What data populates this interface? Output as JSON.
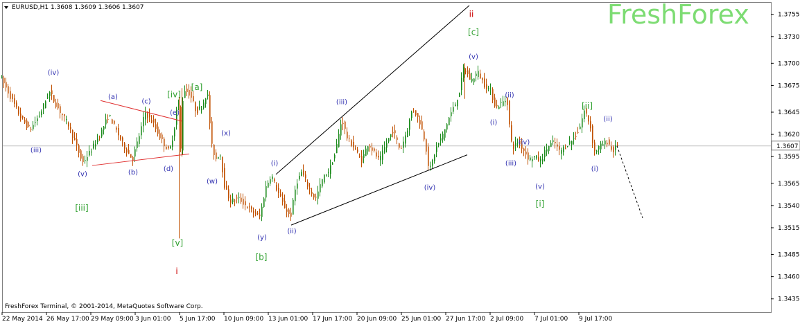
{
  "header": {
    "symbol_line": "EURUSD,H1 1.3608 1.3609 1.3606 1.3607"
  },
  "watermark": {
    "text": "FreshForex"
  },
  "footer": {
    "copyright": "FreshForex Terminal, © 2001-2014, MetaQuotes Software Corp."
  },
  "colors": {
    "bull_candle": "#1a8a1a",
    "bear_candle": "#c05000",
    "price_line": "#c0c0c0",
    "minor_labels": "#3030b0",
    "green_labels": "#2fa02f",
    "red_labels": "#cc0000",
    "triangle_lines": "#e03030",
    "channel_lines": "#000000",
    "watermark": "#7ddc73"
  },
  "chart_data": {
    "type": "candlestick",
    "symbol": "EURUSD",
    "timeframe": "H1",
    "last_bar": {
      "open": 1.3608,
      "high": 1.3609,
      "low": 1.3606,
      "close": 1.3607
    },
    "current_price_label": "1.3607",
    "y_range": [
      1.3425,
      1.3775
    ],
    "y_ticks": [
      "1.3755",
      "1.3730",
      "1.3700",
      "1.3675",
      "1.3645",
      "1.3620",
      "1.3595",
      "1.3565",
      "1.3540",
      "1.3515",
      "1.3485",
      "1.3460",
      "1.3435"
    ],
    "x_ticks": [
      "22 May 2014",
      "26 May 17:00",
      "29 May 09:00",
      "3 Jun 01:00",
      "5 Jun 17:00",
      "10 Jun 09:00",
      "13 Jun 01:00",
      "17 Jun 17:00",
      "20 Jun 09:00",
      "25 Jun 01:00",
      "27 Jun 17:00",
      "2 Jul 09:00",
      "7 Jul 01:00",
      "9 Jul 17:00"
    ],
    "price_path": [
      [
        0,
        1.3688
      ],
      [
        14,
        1.3665
      ],
      [
        30,
        1.364
      ],
      [
        44,
        1.3625
      ],
      [
        58,
        1.3642
      ],
      [
        72,
        1.3668
      ],
      [
        84,
        1.365
      ],
      [
        100,
        1.363
      ],
      [
        112,
        1.3605
      ],
      [
        120,
        1.3588
      ],
      [
        132,
        1.3602
      ],
      [
        145,
        1.362
      ],
      [
        158,
        1.3642
      ],
      [
        168,
        1.3625
      ],
      [
        180,
        1.3606
      ],
      [
        192,
        1.3592
      ],
      [
        202,
        1.362
      ],
      [
        210,
        1.3645
      ],
      [
        222,
        1.3632
      ],
      [
        235,
        1.3612
      ],
      [
        245,
        1.36
      ],
      [
        252,
        1.3625
      ],
      [
        258,
        1.3662
      ],
      [
        262,
        1.3595
      ],
      [
        265,
        1.3672
      ],
      [
        275,
        1.3665
      ],
      [
        284,
        1.3645
      ],
      [
        292,
        1.3652
      ],
      [
        300,
        1.3668
      ],
      [
        306,
        1.3608
      ],
      [
        312,
        1.3592
      ],
      [
        318,
        1.36
      ],
      [
        325,
        1.356
      ],
      [
        333,
        1.3545
      ],
      [
        345,
        1.3548
      ],
      [
        358,
        1.3538
      ],
      [
        370,
        1.353
      ],
      [
        376,
        1.3528
      ],
      [
        384,
        1.356
      ],
      [
        392,
        1.3575
      ],
      [
        400,
        1.3558
      ],
      [
        410,
        1.354
      ],
      [
        420,
        1.3527
      ],
      [
        428,
        1.3565
      ],
      [
        436,
        1.3578
      ],
      [
        446,
        1.356
      ],
      [
        456,
        1.3547
      ],
      [
        466,
        1.357
      ],
      [
        476,
        1.358
      ],
      [
        484,
        1.3598
      ],
      [
        494,
        1.3638
      ],
      [
        502,
        1.3615
      ],
      [
        512,
        1.3605
      ],
      [
        522,
        1.359
      ],
      [
        532,
        1.361
      ],
      [
        540,
        1.36
      ],
      [
        548,
        1.359
      ],
      [
        558,
        1.361
      ],
      [
        568,
        1.3625
      ],
      [
        578,
        1.3602
      ],
      [
        588,
        1.3625
      ],
      [
        596,
        1.365
      ],
      [
        606,
        1.3635
      ],
      [
        614,
        1.3612
      ],
      [
        620,
        1.3578
      ],
      [
        630,
        1.3605
      ],
      [
        640,
        1.362
      ],
      [
        650,
        1.3642
      ],
      [
        658,
        1.3655
      ],
      [
        664,
        1.367
      ],
      [
        670,
        1.3696
      ],
      [
        680,
        1.368
      ],
      [
        690,
        1.369
      ],
      [
        700,
        1.3675
      ],
      [
        708,
        1.367
      ],
      [
        716,
        1.365
      ],
      [
        724,
        1.3655
      ],
      [
        732,
        1.366
      ],
      [
        737,
        1.3618
      ],
      [
        740,
        1.3605
      ],
      [
        748,
        1.3612
      ],
      [
        756,
        1.3603
      ],
      [
        764,
        1.3592
      ],
      [
        772,
        1.3595
      ],
      [
        780,
        1.359
      ],
      [
        790,
        1.3605
      ],
      [
        800,
        1.3612
      ],
      [
        808,
        1.36
      ],
      [
        818,
        1.3608
      ],
      [
        828,
        1.3615
      ],
      [
        836,
        1.3625
      ],
      [
        844,
        1.3648
      ],
      [
        852,
        1.363
      ],
      [
        858,
        1.36
      ],
      [
        864,
        1.3605
      ],
      [
        872,
        1.361
      ],
      [
        878,
        1.3612
      ],
      [
        884,
        1.36
      ],
      [
        890,
        1.3607
      ]
    ],
    "wave_labels": [
      {
        "text": "(iv)",
        "group": "minor",
        "x": 77,
        "price": 1.369
      },
      {
        "text": "(iii)",
        "group": "minor",
        "x": 52,
        "price": 1.3603
      },
      {
        "text": "(v)",
        "group": "minor",
        "x": 119,
        "price": 1.3576
      },
      {
        "text": "[iii]",
        "group": "green",
        "x": 118,
        "price": 1.3537
      },
      {
        "text": "(a)",
        "group": "minor",
        "x": 163,
        "price": 1.3663
      },
      {
        "text": "(b)",
        "group": "minor",
        "x": 192,
        "price": 1.3578
      },
      {
        "text": "(c)",
        "group": "minor",
        "x": 211,
        "price": 1.3658
      },
      {
        "text": "(d)",
        "group": "minor",
        "x": 243,
        "price": 1.3582
      },
      {
        "text": "(e)",
        "group": "minor",
        "x": 252,
        "price": 1.3645
      },
      {
        "text": "[iv]",
        "group": "green",
        "x": 251,
        "price": 1.3665
      },
      {
        "text": "[a]",
        "group": "green",
        "x": 284,
        "price": 1.3673
      },
      {
        "text": "[v]",
        "group": "green",
        "x": 256,
        "price": 1.3498
      },
      {
        "text": "i",
        "group": "red",
        "x": 255,
        "price": 1.3466
      },
      {
        "text": "(x)",
        "group": "minor",
        "x": 326,
        "price": 1.3622
      },
      {
        "text": "(w)",
        "group": "minor",
        "x": 306,
        "price": 1.3568
      },
      {
        "text": "(y)",
        "group": "minor",
        "x": 378,
        "price": 1.3505
      },
      {
        "text": "[b]",
        "group": "green",
        "x": 377,
        "price": 1.3482
      },
      {
        "text": "(i)",
        "group": "minor",
        "x": 396,
        "price": 1.3588
      },
      {
        "text": "(ii)",
        "group": "minor",
        "x": 421,
        "price": 1.3512
      },
      {
        "text": "(iii)",
        "group": "minor",
        "x": 493,
        "price": 1.3657
      },
      {
        "text": "(iv)",
        "group": "minor",
        "x": 620,
        "price": 1.3561
      },
      {
        "text": "ii",
        "group": "red",
        "x": 680,
        "price": 1.3755
      },
      {
        "text": "[c]",
        "group": "green",
        "x": 683,
        "price": 1.3735
      },
      {
        "text": "(v)",
        "group": "minor",
        "x": 683,
        "price": 1.3708
      },
      {
        "text": "(ii)",
        "group": "minor",
        "x": 735,
        "price": 1.3665
      },
      {
        "text": "(i)",
        "group": "minor",
        "x": 712,
        "price": 1.3634
      },
      {
        "text": "(iv)",
        "group": "minor",
        "x": 756,
        "price": 1.3612
      },
      {
        "text": "(iii)",
        "group": "minor",
        "x": 737,
        "price": 1.3588
      },
      {
        "text": "(v)",
        "group": "minor",
        "x": 779,
        "price": 1.3562
      },
      {
        "text": "[i]",
        "group": "green",
        "x": 779,
        "price": 1.3542
      },
      {
        "text": "[ii]",
        "group": "green",
        "x": 847,
        "price": 1.3652
      },
      {
        "text": "(ii)",
        "group": "minor",
        "x": 877,
        "price": 1.3638
      },
      {
        "text": "(i)",
        "group": "minor",
        "x": 858,
        "price": 1.3582
      }
    ],
    "trend_lines": [
      {
        "group": "triangle",
        "from": [
          145,
          1.3658
        ],
        "to": [
          262,
          1.3635
        ]
      },
      {
        "group": "triangle",
        "from": [
          133,
          1.3585
        ],
        "to": [
          273,
          1.3598
        ]
      },
      {
        "group": "channel",
        "from": [
          398,
          1.3575
        ],
        "to": [
          677,
          1.3765
        ]
      },
      {
        "group": "channel",
        "from": [
          420,
          1.3518
        ],
        "to": [
          674,
          1.3597
        ]
      }
    ],
    "projection": {
      "from": [
        890,
        1.3607
      ],
      "to": [
        927,
        1.3526
      ]
    },
    "grid": false,
    "legend": "none"
  }
}
